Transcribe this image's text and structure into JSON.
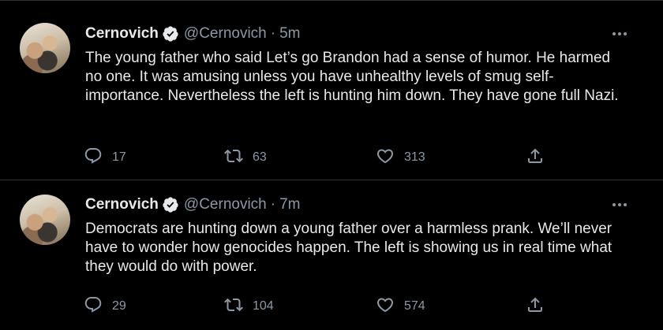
{
  "tweets": [
    {
      "author": "Cernovich",
      "handle": "@Cernovich",
      "separator": "·",
      "time": "5m",
      "text": "The young father who said Let’s go Brandon had a sense of humor. He harmed no one. It was amusing unless you have unhealthy levels of smug self-importance. Nevertheless the left is hunting him down. They have gone full Nazi.",
      "replies": "17",
      "retweets": "63",
      "likes": "313"
    },
    {
      "author": "Cernovich",
      "handle": "@Cernovich",
      "separator": "·",
      "time": "7m",
      "text": "Democrats are hunting down a young father over a harmless prank. We’ll never have to wonder how genocides happen. The left is showing us in real time what they would do with power.",
      "replies": "29",
      "retweets": "104",
      "likes": "574"
    }
  ],
  "colors": {
    "background": "#000000",
    "text": "#e7e9ea",
    "secondary": "#8b98a5",
    "divider": "#2f3336",
    "verified_badge": "#e7e9ea"
  },
  "icons": [
    "verified-badge-icon",
    "more-icon",
    "reply-icon",
    "retweet-icon",
    "like-icon",
    "share-icon"
  ]
}
